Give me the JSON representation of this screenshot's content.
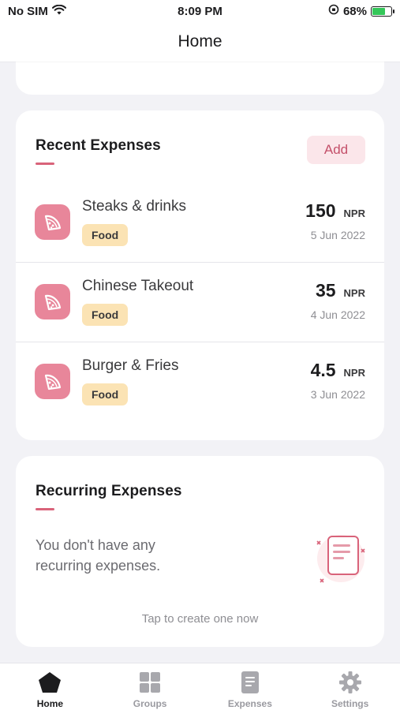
{
  "status_bar": {
    "carrier": "No SIM",
    "time": "8:09 PM",
    "battery": "68%",
    "battery_level": 0.68
  },
  "nav": {
    "title": "Home"
  },
  "recent": {
    "title": "Recent Expenses",
    "add_label": "Add",
    "items": [
      {
        "name": "Steaks & drinks",
        "category": "Food",
        "amount": "150",
        "currency": "NPR",
        "date": "5 Jun 2022",
        "icon": "pizza-icon"
      },
      {
        "name": "Chinese Takeout",
        "category": "Food",
        "amount": "35",
        "currency": "NPR",
        "date": "4 Jun 2022",
        "icon": "pizza-icon"
      },
      {
        "name": "Burger & Fries",
        "category": "Food",
        "amount": "4.5",
        "currency": "NPR",
        "date": "3 Jun 2022",
        "icon": "pizza-icon"
      }
    ]
  },
  "recurring": {
    "title": "Recurring Expenses",
    "empty_text": "You don't have any recurring expenses.",
    "cta": "Tap to create one now",
    "illustration": "document-icon"
  },
  "tabs": [
    {
      "label": "Home",
      "icon": "home-icon",
      "active": true
    },
    {
      "label": "Groups",
      "icon": "grid-icon",
      "active": false
    },
    {
      "label": "Expenses",
      "icon": "document-icon",
      "active": false
    },
    {
      "label": "Settings",
      "icon": "gear-icon",
      "active": false
    }
  ],
  "colors": {
    "accent": "#d9637a",
    "icon_bg": "#e8869a",
    "tag_bg": "#fbe3b4",
    "battery": "#34c759"
  }
}
